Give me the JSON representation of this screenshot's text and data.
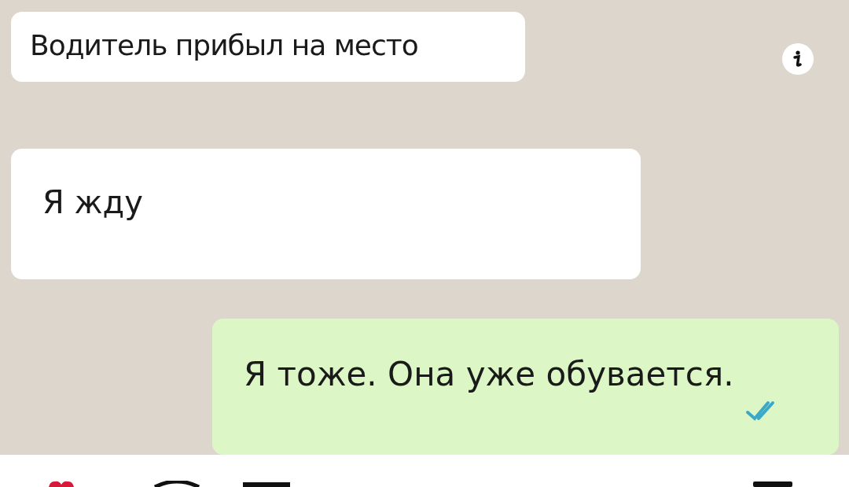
{
  "messages": [
    {
      "kind": "incoming",
      "text": "Водитель прибыл на место"
    },
    {
      "kind": "incoming_tail",
      "text": "Я жду"
    },
    {
      "kind": "outgoing",
      "text": "Я тоже. Она уже обувается.",
      "read": true
    }
  ]
}
